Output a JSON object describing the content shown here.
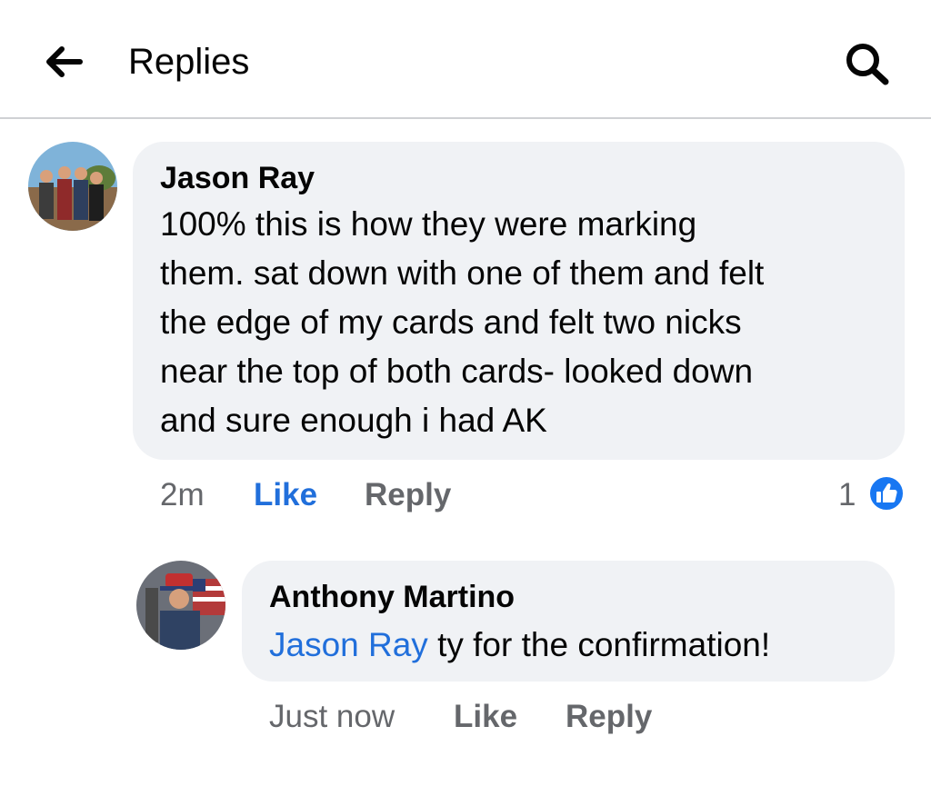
{
  "header": {
    "title": "Replies",
    "back_icon": "arrow-left-icon",
    "search_icon": "search-icon"
  },
  "comments": [
    {
      "author": "Jason Ray",
      "body_lines": [
        "100% this is how they were marking",
        "them. sat down with one of them and felt",
        "the edge of my cards and felt two nicks",
        "near the top of both cards- looked down",
        "and sure enough i had AK"
      ],
      "time": "2m",
      "like_label": "Like",
      "reply_label": "Reply",
      "reaction_count": "1",
      "reaction_icon": "thumbs-up-icon"
    },
    {
      "author": "Anthony Martino",
      "mention": "Jason Ray",
      "body_rest": " ty for the confirmation!",
      "time": "Just now",
      "like_label": "Like",
      "reply_label": "Reply"
    }
  ],
  "colors": {
    "accent": "#216fdb",
    "bubble": "#f0f2f5",
    "meta": "#65676b",
    "like_badge": "#1877f2"
  }
}
